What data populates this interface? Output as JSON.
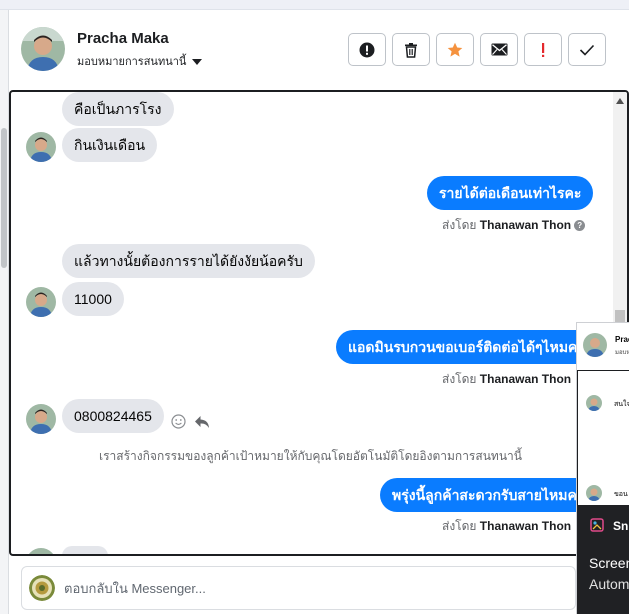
{
  "header": {
    "contact_name": "Pracha Maka",
    "assign_label": "มอบหมายการสนทนานี้",
    "actions": [
      {
        "name": "spam-button",
        "icon": "alert-circle-icon"
      },
      {
        "name": "delete-button",
        "icon": "trash-icon"
      },
      {
        "name": "star-button",
        "icon": "star-icon"
      },
      {
        "name": "mail-button",
        "icon": "envelope-icon"
      },
      {
        "name": "follow-up-button",
        "icon": "exclamation-icon"
      },
      {
        "name": "done-button",
        "icon": "checkmark-icon"
      }
    ]
  },
  "messages": {
    "m1": "คือเป็นภารโรง",
    "m2": "กินเงินเดือน",
    "m3": "รายได้ต่อเดือนเท่าไรคะ",
    "m4": "แล้วทางนั้ยต้องการรายได้ยังงัยน้อครับ",
    "m5": "11000",
    "m6": "แอดมินรบกวนขอเบอร์ติดต่อได้ๆไหมคะ",
    "m7": "0800824465",
    "m8": "พรุ่งนี้ลูกค้าสะดวกรับสายไหมคะ"
  },
  "sent_by": {
    "prefix": "ส่งโดย",
    "agent": "Thanawan Thon"
  },
  "system_note": "เราสร้างกิจกรรมของลูกค้าเป้าหมายให้กับคุณโดยอัตโนมัติโดยอิงตามการสนทนานี้",
  "composer": {
    "placeholder": "ตอบกลับใน Messenger..."
  },
  "popup": {
    "name": "Prac",
    "sub": "มอบห",
    "preview1": "สนใจ",
    "preview2": "ขอน"
  },
  "notification": {
    "app": "Snip",
    "line1": "Screen",
    "line2": "Autom"
  },
  "colors": {
    "outgoing_bubble": "#0a7cff",
    "incoming_bubble": "#e4e6eb",
    "star": "#f5923e",
    "follow_up": "#e4292d"
  }
}
